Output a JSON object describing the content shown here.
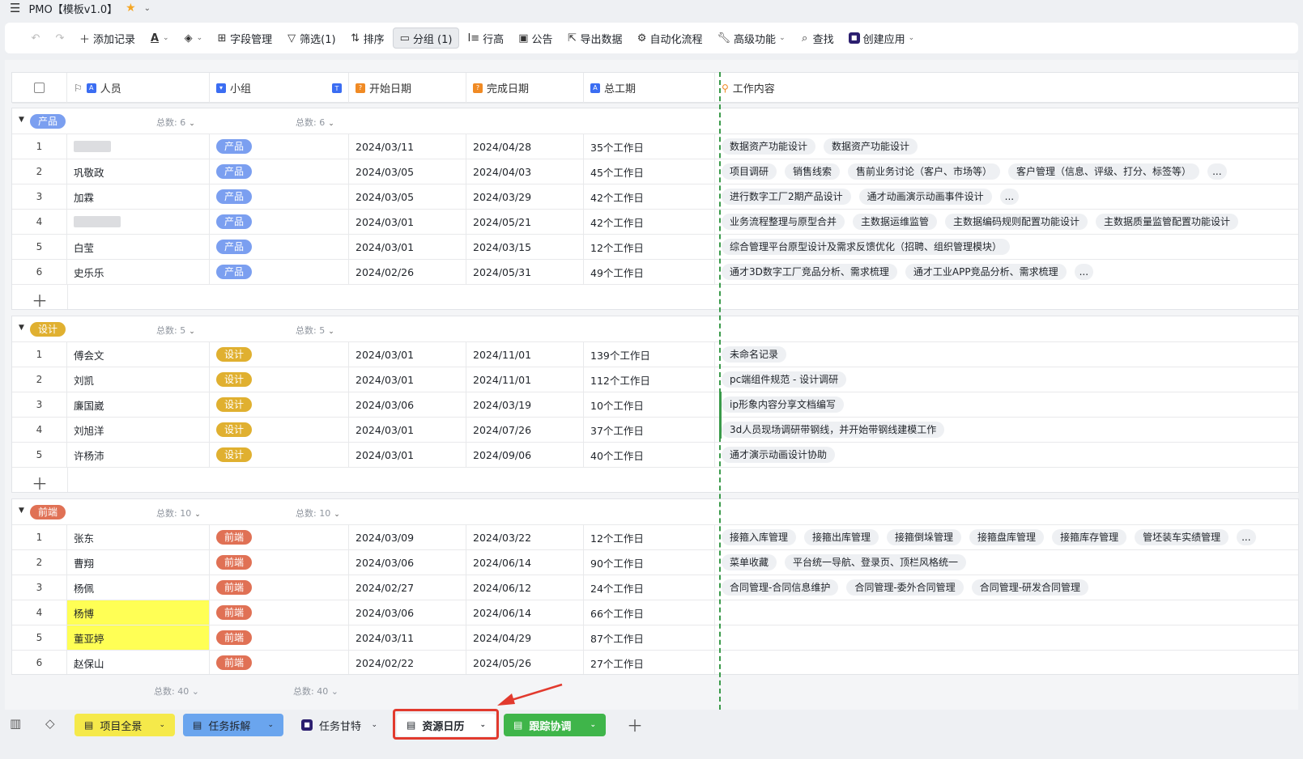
{
  "titlebar": {
    "title": "PMO【模板v1.0】"
  },
  "toolbar": {
    "add_record": "添加记录",
    "field_manage": "字段管理",
    "filter": "筛选(1)",
    "sort": "排序",
    "group": "分组 (1)",
    "row_height": "行高",
    "announcement": "公告",
    "export": "导出数据",
    "automation": "自动化流程",
    "advanced": "高级功能",
    "search": "查找",
    "create_app": "创建应用"
  },
  "columns": {
    "person": "人员",
    "team": "小组",
    "start_date": "开始日期",
    "end_date": "完成日期",
    "total_days": "总工期",
    "work_content": "工作内容"
  },
  "colors": {
    "product": "#7b9ff0",
    "design": "#e0b030",
    "frontend": "#e07155",
    "highlight": "#ffff55"
  },
  "groups": [
    {
      "name": "产品",
      "count_label": "总数: 6",
      "rows": [
        {
          "n": "1",
          "person": "",
          "team": "产品",
          "start": "2024/03/11",
          "end": "2024/04/28",
          "days": "35个工作日",
          "work": [
            "数据资产功能设计",
            "数据资产功能设计"
          ]
        },
        {
          "n": "2",
          "person": "巩敬政",
          "team": "产品",
          "start": "2024/03/05",
          "end": "2024/04/03",
          "days": "45个工作日",
          "work": [
            "项目调研",
            "销售线索",
            "售前业务讨论（客户、市场等）",
            "客户管理（信息、评级、打分、标签等）",
            "..."
          ]
        },
        {
          "n": "3",
          "person": "加霖",
          "team": "产品",
          "start": "2024/03/05",
          "end": "2024/03/29",
          "days": "42个工作日",
          "work": [
            "进行数字工厂2期产品设计",
            "通才动画演示动画事件设计",
            "..."
          ]
        },
        {
          "n": "4",
          "person": "",
          "team": "产品",
          "start": "2024/03/01",
          "end": "2024/05/21",
          "days": "42个工作日",
          "work": [
            "业务流程整理与原型合并",
            "主数据运维监管",
            "主数据编码规则配置功能设计",
            "主数据质量监管配置功能设计"
          ]
        },
        {
          "n": "5",
          "person": "白莹",
          "team": "产品",
          "start": "2024/03/01",
          "end": "2024/03/15",
          "days": "12个工作日",
          "work": [
            "综合管理平台原型设计及需求反馈优化（招聘、组织管理模块）"
          ]
        },
        {
          "n": "6",
          "person": "史乐乐",
          "team": "产品",
          "start": "2024/02/26",
          "end": "2024/05/31",
          "days": "49个工作日",
          "work": [
            "通才3D数字工厂竞品分析、需求梳理",
            "通才工业APP竞品分析、需求梳理",
            "..."
          ]
        }
      ]
    },
    {
      "name": "设计",
      "count_label": "总数: 5",
      "rows": [
        {
          "n": "1",
          "person": "傅会文",
          "team": "设计",
          "start": "2024/03/01",
          "end": "2024/11/01",
          "days": "139个工作日",
          "work": [
            "未命名记录"
          ]
        },
        {
          "n": "2",
          "person": "刘凯",
          "team": "设计",
          "start": "2024/03/01",
          "end": "2024/11/01",
          "days": "112个工作日",
          "work": [
            "pc端组件规范 - 设计调研"
          ]
        },
        {
          "n": "3",
          "person": "廉国崴",
          "team": "设计",
          "start": "2024/03/06",
          "end": "2024/03/19",
          "days": "10个工作日",
          "work": [
            "ip形象内容分享文档编写"
          ]
        },
        {
          "n": "4",
          "person": "刘旭洋",
          "team": "设计",
          "start": "2024/03/01",
          "end": "2024/07/26",
          "days": "37个工作日",
          "work": [
            "3d人员现场调研带钢线，并开始带钢线建模工作"
          ]
        },
        {
          "n": "5",
          "person": "许杨沛",
          "team": "设计",
          "start": "2024/03/01",
          "end": "2024/09/06",
          "days": "40个工作日",
          "work": [
            "通才演示动画设计协助"
          ]
        }
      ]
    },
    {
      "name": "前端",
      "count_label": "总数: 10",
      "rows": [
        {
          "n": "1",
          "person": "张东",
          "team": "前端",
          "start": "2024/03/09",
          "end": "2024/03/22",
          "days": "12个工作日",
          "work": [
            "接箍入库管理",
            "接箍出库管理",
            "接箍倒垛管理",
            "接箍盘库管理",
            "接箍库存管理",
            "管坯装车实绩管理",
            "..."
          ]
        },
        {
          "n": "2",
          "person": "曹翔",
          "team": "前端",
          "start": "2024/03/06",
          "end": "2024/06/14",
          "days": "90个工作日",
          "work": [
            "菜单收藏",
            "平台统一导航、登录页、顶栏风格统一"
          ]
        },
        {
          "n": "3",
          "person": "杨佩",
          "team": "前端",
          "start": "2024/02/27",
          "end": "2024/06/12",
          "days": "24个工作日",
          "work": [
            "合同管理-合同信息维护",
            "合同管理-委外合同管理",
            "合同管理-研发合同管理"
          ]
        },
        {
          "n": "4",
          "person": "杨博",
          "team": "前端",
          "start": "2024/03/06",
          "end": "2024/06/14",
          "days": "66个工作日",
          "work": [],
          "highlight": true
        },
        {
          "n": "5",
          "person": "董亚婷",
          "team": "前端",
          "start": "2024/03/11",
          "end": "2024/04/29",
          "days": "87个工作日",
          "work": [],
          "highlight": true
        },
        {
          "n": "6",
          "person": "赵保山",
          "team": "前端",
          "start": "2024/02/22",
          "end": "2024/05/26",
          "days": "27个工作日",
          "work": []
        }
      ]
    }
  ],
  "footer": {
    "count_label": "总数: 40"
  },
  "tabs": [
    {
      "label": "项目全景",
      "bg": "#f5e94a"
    },
    {
      "label": "任务拆解",
      "bg": "#6aa5ee"
    },
    {
      "label": "任务甘特",
      "bg": "#eef0f3"
    },
    {
      "label": "资源日历",
      "bg": "#ffffff"
    },
    {
      "label": "跟踪协调",
      "bg": "#3fb54a"
    }
  ]
}
